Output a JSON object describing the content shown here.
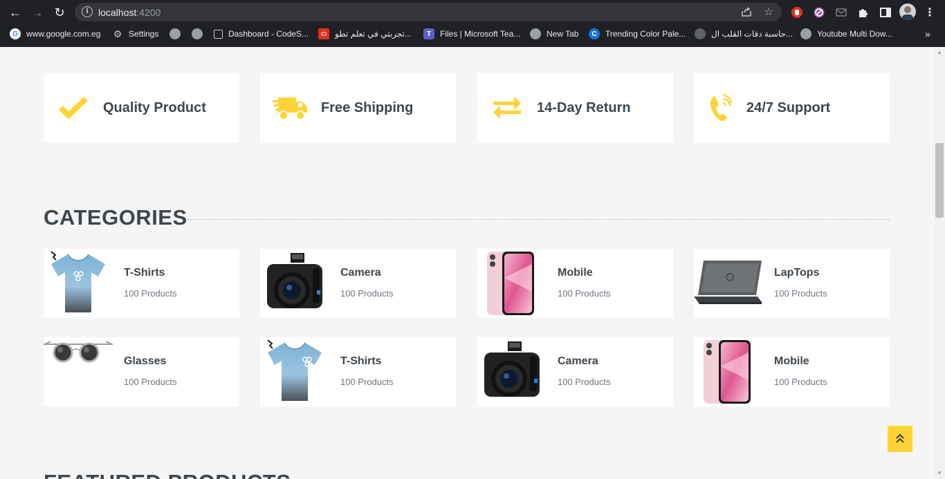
{
  "browser": {
    "url_host": "localhost",
    "url_port": ":4200",
    "bookmarks": [
      {
        "label": "www.google.com.eg"
      },
      {
        "label": "Settings"
      },
      {
        "label": ""
      },
      {
        "label": ""
      },
      {
        "label": "Dashboard - CodeS..."
      },
      {
        "label": "تجربتي في تعلم تطو..."
      },
      {
        "label": "Files | Microsoft Tea..."
      },
      {
        "label": "New Tab"
      },
      {
        "label": "Trending Color Pale..."
      },
      {
        "label": "حاسبة دقات القلب ال..."
      },
      {
        "label": "Youtube Multi Dow..."
      }
    ]
  },
  "features": [
    {
      "label": "Quality Product",
      "icon": "check-icon"
    },
    {
      "label": "Free Shipping",
      "icon": "truck-icon"
    },
    {
      "label": "14-Day Return",
      "icon": "exchange-arrows-icon"
    },
    {
      "label": "24/7 Support",
      "icon": "phone-icon"
    }
  ],
  "categories_title": "CATEGORIES",
  "categories": [
    {
      "name": "T-Shirts",
      "count": "100 Products",
      "image": "tshirt-image"
    },
    {
      "name": "Camera",
      "count": "100 Products",
      "image": "camera-image"
    },
    {
      "name": "Mobile",
      "count": "100 Products",
      "image": "mobile-image"
    },
    {
      "name": "LapTops",
      "count": "100 Products",
      "image": "laptop-image"
    },
    {
      "name": "Glasses",
      "count": "100 Products",
      "image": "glasses-image"
    },
    {
      "name": "T-Shirts",
      "count": "100 Products",
      "image": "tshirt-image"
    },
    {
      "name": "Camera",
      "count": "100 Products",
      "image": "camera-image"
    },
    {
      "name": "Mobile",
      "count": "100 Products",
      "image": "mobile-image"
    }
  ],
  "featured_title": "FEATURED PRODUCTS",
  "colors": {
    "accent": "#FFD333",
    "text": "#3D464D",
    "muted": "#6C757D",
    "page_bg": "#F5F5F5"
  },
  "back_to_top_icon": "double-chevron-up-icon"
}
